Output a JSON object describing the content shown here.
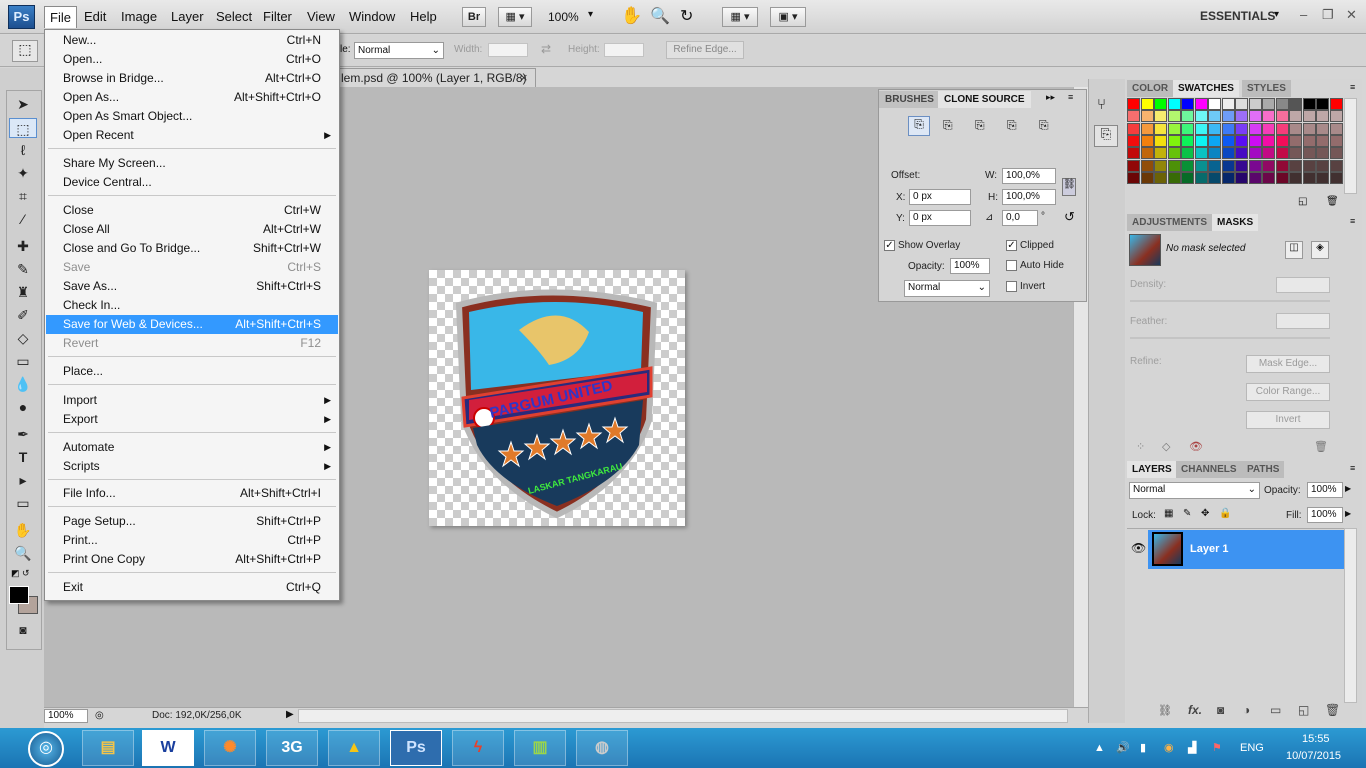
{
  "app": {
    "logo": "Ps"
  },
  "menubar": {
    "items": [
      "File",
      "Edit",
      "Image",
      "Layer",
      "Select",
      "Filter",
      "View",
      "Window",
      "Help"
    ],
    "bridge_btn": "Br",
    "zoom": "100%",
    "workspace": "ESSENTIALS"
  },
  "options": {
    "style_value": "Normal",
    "style_label_partial": "le:",
    "width_label": "Width:",
    "height_label": "Height:",
    "refine_edge": "Refine Edge..."
  },
  "document": {
    "tab_title": "lem.psd @ 100% (Layer 1, RGB/8)",
    "close": "×",
    "zoom": "100%",
    "doc_info": "Doc: 192,0K/256,0K",
    "logo_text_top": "PARGUM UNITED",
    "logo_text_bottom": "LASKAR TANGKARAU"
  },
  "file_menu": {
    "items": [
      {
        "label": "New...",
        "shortcut": "Ctrl+N"
      },
      {
        "label": "Open...",
        "shortcut": "Ctrl+O"
      },
      {
        "label": "Browse in Bridge...",
        "shortcut": "Alt+Ctrl+O"
      },
      {
        "label": "Open As...",
        "shortcut": "Alt+Shift+Ctrl+O"
      },
      {
        "label": "Open As Smart Object...",
        "shortcut": ""
      },
      {
        "label": "Open Recent",
        "shortcut": ""
      },
      {
        "label": "Share My Screen...",
        "shortcut": ""
      },
      {
        "label": "Device Central...",
        "shortcut": ""
      },
      {
        "label": "Close",
        "shortcut": "Ctrl+W"
      },
      {
        "label": "Close All",
        "shortcut": "Alt+Ctrl+W"
      },
      {
        "label": "Close and Go To Bridge...",
        "shortcut": "Shift+Ctrl+W"
      },
      {
        "label": "Save",
        "shortcut": "Ctrl+S"
      },
      {
        "label": "Save As...",
        "shortcut": "Shift+Ctrl+S"
      },
      {
        "label": "Check In...",
        "shortcut": ""
      },
      {
        "label": "Save for Web & Devices...",
        "shortcut": "Alt+Shift+Ctrl+S"
      },
      {
        "label": "Revert",
        "shortcut": "F12"
      },
      {
        "label": "Place...",
        "shortcut": ""
      },
      {
        "label": "Import",
        "shortcut": ""
      },
      {
        "label": "Export",
        "shortcut": ""
      },
      {
        "label": "Automate",
        "shortcut": ""
      },
      {
        "label": "Scripts",
        "shortcut": ""
      },
      {
        "label": "File Info...",
        "shortcut": "Alt+Shift+Ctrl+I"
      },
      {
        "label": "Page Setup...",
        "shortcut": "Shift+Ctrl+P"
      },
      {
        "label": "Print...",
        "shortcut": "Ctrl+P"
      },
      {
        "label": "Print One Copy",
        "shortcut": "Alt+Shift+Ctrl+P"
      },
      {
        "label": "Exit",
        "shortcut": "Ctrl+Q"
      }
    ]
  },
  "clone_source": {
    "tabs": [
      "BRUSHES",
      "CLONE SOURCE"
    ],
    "offset_label": "Offset:",
    "w_label": "W:",
    "w_value": "100,0%",
    "h_label": "H:",
    "h_value": "100,0%",
    "x_label": "X:",
    "x_value": "0 px",
    "y_label": "Y:",
    "y_value": "0 px",
    "angle_value": "0,0",
    "degree": "°",
    "show_overlay": "Show Overlay",
    "clipped": "Clipped",
    "opacity_label": "Opacity:",
    "opacity_value": "100%",
    "auto_hide": "Auto Hide",
    "mode": "Normal",
    "invert": "Invert"
  },
  "swatches": {
    "tabs": [
      "COLOR",
      "SWATCHES",
      "STYLES"
    ]
  },
  "adjustments": {
    "tabs": [
      "ADJUSTMENTS",
      "MASKS"
    ],
    "no_mask": "No mask selected",
    "density": "Density:",
    "feather": "Feather:",
    "refine": "Refine:",
    "mask_edge": "Mask Edge...",
    "color_range": "Color Range...",
    "invert": "Invert"
  },
  "layers": {
    "tabs": [
      "LAYERS",
      "CHANNELS",
      "PATHS"
    ],
    "blend": "Normal",
    "opacity_label": "Opacity:",
    "opacity_value": "100%",
    "lock_label": "Lock:",
    "fill_label": "Fill:",
    "fill_value": "100%",
    "layer_name": "Layer 1"
  },
  "taskbar": {
    "lang": "ENG",
    "time": "15:55",
    "date": "10/07/2015",
    "threeg": "3G",
    "word": "W",
    "ps": "Ps"
  }
}
